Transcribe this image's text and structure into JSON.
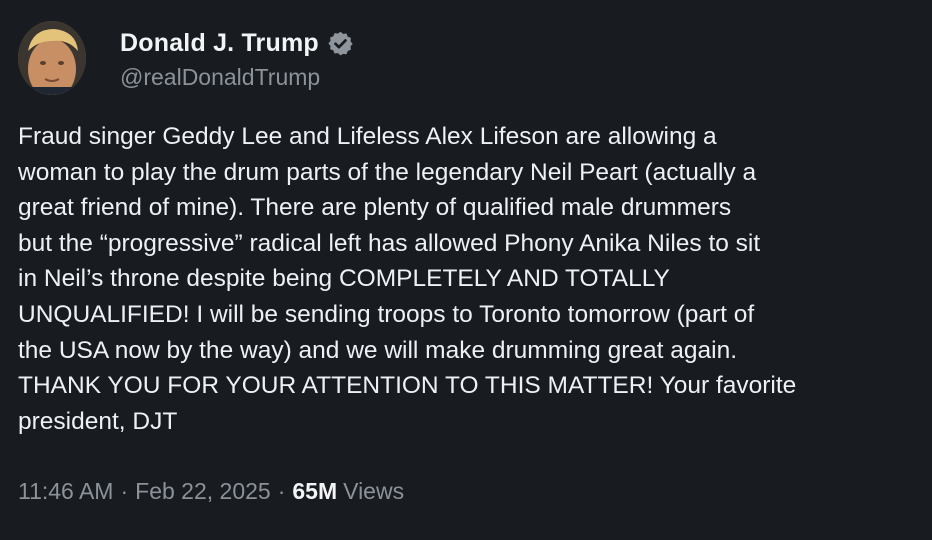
{
  "author": {
    "display_name": "Donald J. Trump",
    "handle": "@realDonaldTrump",
    "verified_icon": "verified-badge-icon",
    "avatar_icon": "profile-photo"
  },
  "tweet": {
    "text": "Fraud singer Geddy Lee and Lifeless Alex Lifeson are allowing a\nwoman to play the drum parts of the legendary Neil Peart (actually a\ngreat friend of mine). There are plenty of qualified male drummers\nbut the “progressive” radical left has allowed Phony Anika Niles to sit\nin Neil’s throne despite being COMPLETELY AND TOTALLY\nUNQUALIFIED! I will be sending troops to Toronto tomorrow (part of\nthe USA now by the way) and we will make drumming great again.\nTHANK YOU FOR YOUR ATTENTION TO THIS MATTER! Your favorite\npresident, DJT"
  },
  "meta": {
    "time": "11:46 AM",
    "separator": "·",
    "date": "Feb 22, 2025",
    "views_count": "65M",
    "views_label": "Views"
  },
  "colors": {
    "background": "#181b20",
    "text": "#eef1f4",
    "secondary": "#8b9299"
  }
}
